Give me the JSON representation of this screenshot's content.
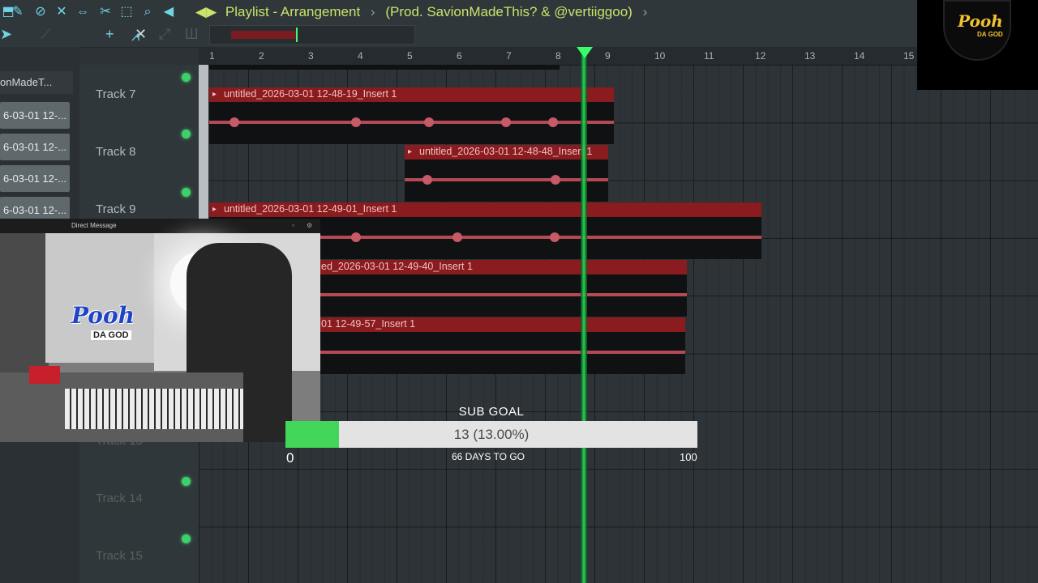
{
  "toolbar": {
    "icons": [
      "magnet-icon",
      "paint-icon",
      "delete-icon",
      "mute-icon",
      "slip-icon",
      "slice-icon",
      "select-icon",
      "zoom-icon",
      "speaker-icon"
    ],
    "breadcrumb": [
      "Playlist - Arrangement",
      "(Prod. SavionMadeThis? & @vertiiggoo)"
    ]
  },
  "ruler": {
    "bars": [
      "1",
      "2",
      "3",
      "4",
      "5",
      "6",
      "7",
      "8",
      "9",
      "10",
      "11",
      "12",
      "13",
      "14",
      "15"
    ]
  },
  "picker": {
    "header": "onMadeT...",
    "items": [
      "6-03-01 12-...",
      "6-03-01 12-...",
      "6-03-01 12-...",
      "6-03-01 12-..."
    ]
  },
  "tracks": [
    {
      "label": "Track 7"
    },
    {
      "label": "Track 8"
    },
    {
      "label": "Track 9"
    },
    {
      "label": "Track 13"
    },
    {
      "label": "Track 14"
    },
    {
      "label": "Track 15"
    }
  ],
  "clips": [
    {
      "title": "untitled_2026-03-01 12-48-19_Insert 1"
    },
    {
      "title": "untitled_2026-03-01 12-48-48_Insert 1"
    },
    {
      "title": "untitled_2026-03-01 12-49-01_Insert 1"
    },
    {
      "title": "ed_2026-03-01 12-49-40_Insert 1"
    },
    {
      "title": "01 12-49-57_Insert 1"
    }
  ],
  "logo": {
    "text": "Pooh",
    "sub": "DA GOD"
  },
  "webcam": {
    "window_title": "Direct Message",
    "overlay_logo": "Pooh",
    "overlay_sub": "DA GOD"
  },
  "sub_goal": {
    "label": "SUB GOAL",
    "current_text": "13 (13.00%)",
    "current": 13,
    "min": "0",
    "max": "100",
    "days": "66 DAYS TO GO",
    "fill_fraction": 0.13
  },
  "colors": {
    "accent": "#6fd6e6",
    "title": "#c9e36b",
    "clip": "#8a1b1f",
    "playhead": "#39ff6a",
    "goal_fill": "#43d65a"
  }
}
